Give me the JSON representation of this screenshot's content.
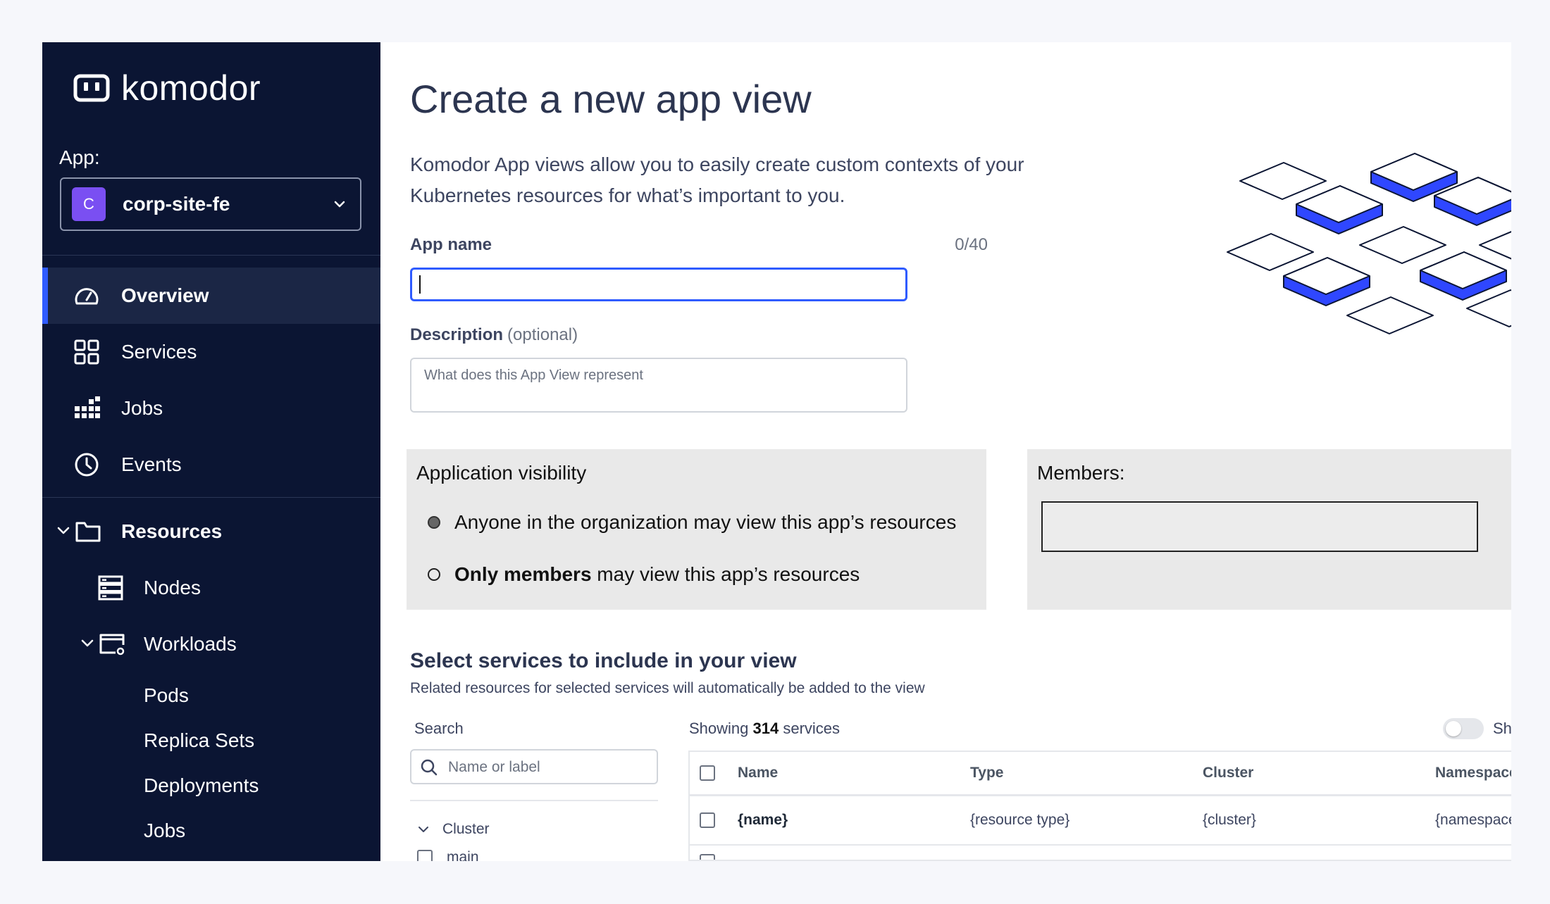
{
  "sidebar": {
    "logo_text": "komodor",
    "app_label": "App:",
    "app_badge": "C",
    "app_name": "corp-site-fe",
    "nav": {
      "overview": "Overview",
      "services": "Services",
      "jobs": "Jobs",
      "events": "Events",
      "resources": "Resources",
      "nodes": "Nodes",
      "workloads": "Workloads",
      "pods": "Pods",
      "replica_sets": "Replica Sets",
      "deployments": "Deployments",
      "jobs_sub": "Jobs"
    },
    "active_item": "Overview"
  },
  "main": {
    "title": "Create a new app view",
    "intro": "Komodor App views allow you to easily create custom contexts of your Kubernetes resources for what’s important to you.",
    "app_name_label": "App name",
    "app_name_counter": "0/40",
    "app_name_value": "",
    "description_label": "Description",
    "description_optional": "(optional)",
    "description_placeholder": "What does this App View represent",
    "visibility": {
      "title": "Application visibility",
      "option_anyone": "Anyone in the organization may view this app’s resources",
      "option_members_bold": "Only members",
      "option_members_rest": " may view this app’s resources",
      "selected": "anyone"
    },
    "members": {
      "title": "Members:",
      "value": ""
    },
    "services_section": {
      "title": "Select services to include in your view",
      "subtitle": "Related resources for selected services will automatically be added to the view",
      "search_label": "Search",
      "search_placeholder": "Name or label",
      "filter_group": "Cluster",
      "filter_option": "main",
      "showing_prefix": "Showing",
      "showing_count": "314",
      "showing_suffix": "services",
      "toggle_label": "Sh",
      "columns": [
        "Name",
        "Type",
        "Cluster",
        "Namespace"
      ],
      "rows": [
        [
          "{name}",
          "{resource type}",
          "{cluster}",
          "{namespace"
        ]
      ]
    }
  },
  "colors": {
    "sidebar_bg": "#0b1533",
    "accent": "#2f5bff",
    "badge": "#7a4ff2"
  }
}
